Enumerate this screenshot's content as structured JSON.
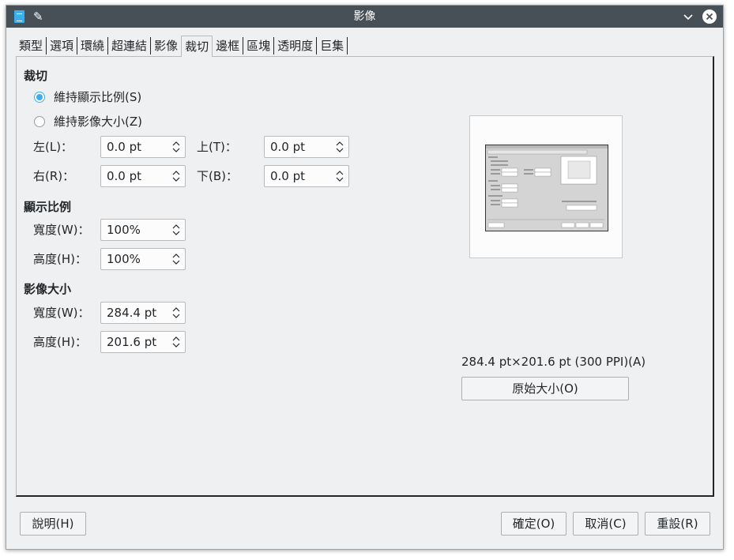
{
  "window": {
    "title": "影像"
  },
  "titlebar_icons": [
    "app-icon",
    "pin-icon",
    "chevron-down-icon",
    "close-icon"
  ],
  "tabs": [
    {
      "label": "類型"
    },
    {
      "label": "選項"
    },
    {
      "label": "環繞"
    },
    {
      "label": "超連結"
    },
    {
      "label": "影像"
    },
    {
      "label": "裁切",
      "active": true
    },
    {
      "label": "邊框"
    },
    {
      "label": "區塊"
    },
    {
      "label": "透明度"
    },
    {
      "label": "巨集"
    }
  ],
  "crop": {
    "title": "裁切",
    "keep_scale": "維持顯示比例(S)",
    "keep_size": "維持影像大小(Z)",
    "selected": "keep_scale",
    "left_label": "左(L)：",
    "left_value": "0.0 pt",
    "top_label": "上(T)：",
    "top_value": "0.0 pt",
    "right_label": "右(R)：",
    "right_value": "0.0 pt",
    "bottom_label": "下(B)：",
    "bottom_value": "0.0 pt"
  },
  "scale": {
    "title": "顯示比例",
    "width_label": "寬度(W)：",
    "width_value": "100%",
    "height_label": "高度(H)：",
    "height_value": "100%"
  },
  "image_size": {
    "title": "影像大小",
    "width_label": "寬度(W)：",
    "width_value": "284.4 pt",
    "height_label": "高度(H)：",
    "height_value": "201.6 pt"
  },
  "preview": {
    "size_text": "284.4 pt×201.6 pt (300 PPI)(A)",
    "original_size_button": "原始大小(O)"
  },
  "buttons": {
    "help": "說明(H)",
    "ok": "確定(O)",
    "cancel": "取消(C)",
    "reset": "重設(R)"
  },
  "colors": {
    "titlebar": "#475057",
    "accent": "#3daee9",
    "window_bg": "#eff0f1"
  }
}
